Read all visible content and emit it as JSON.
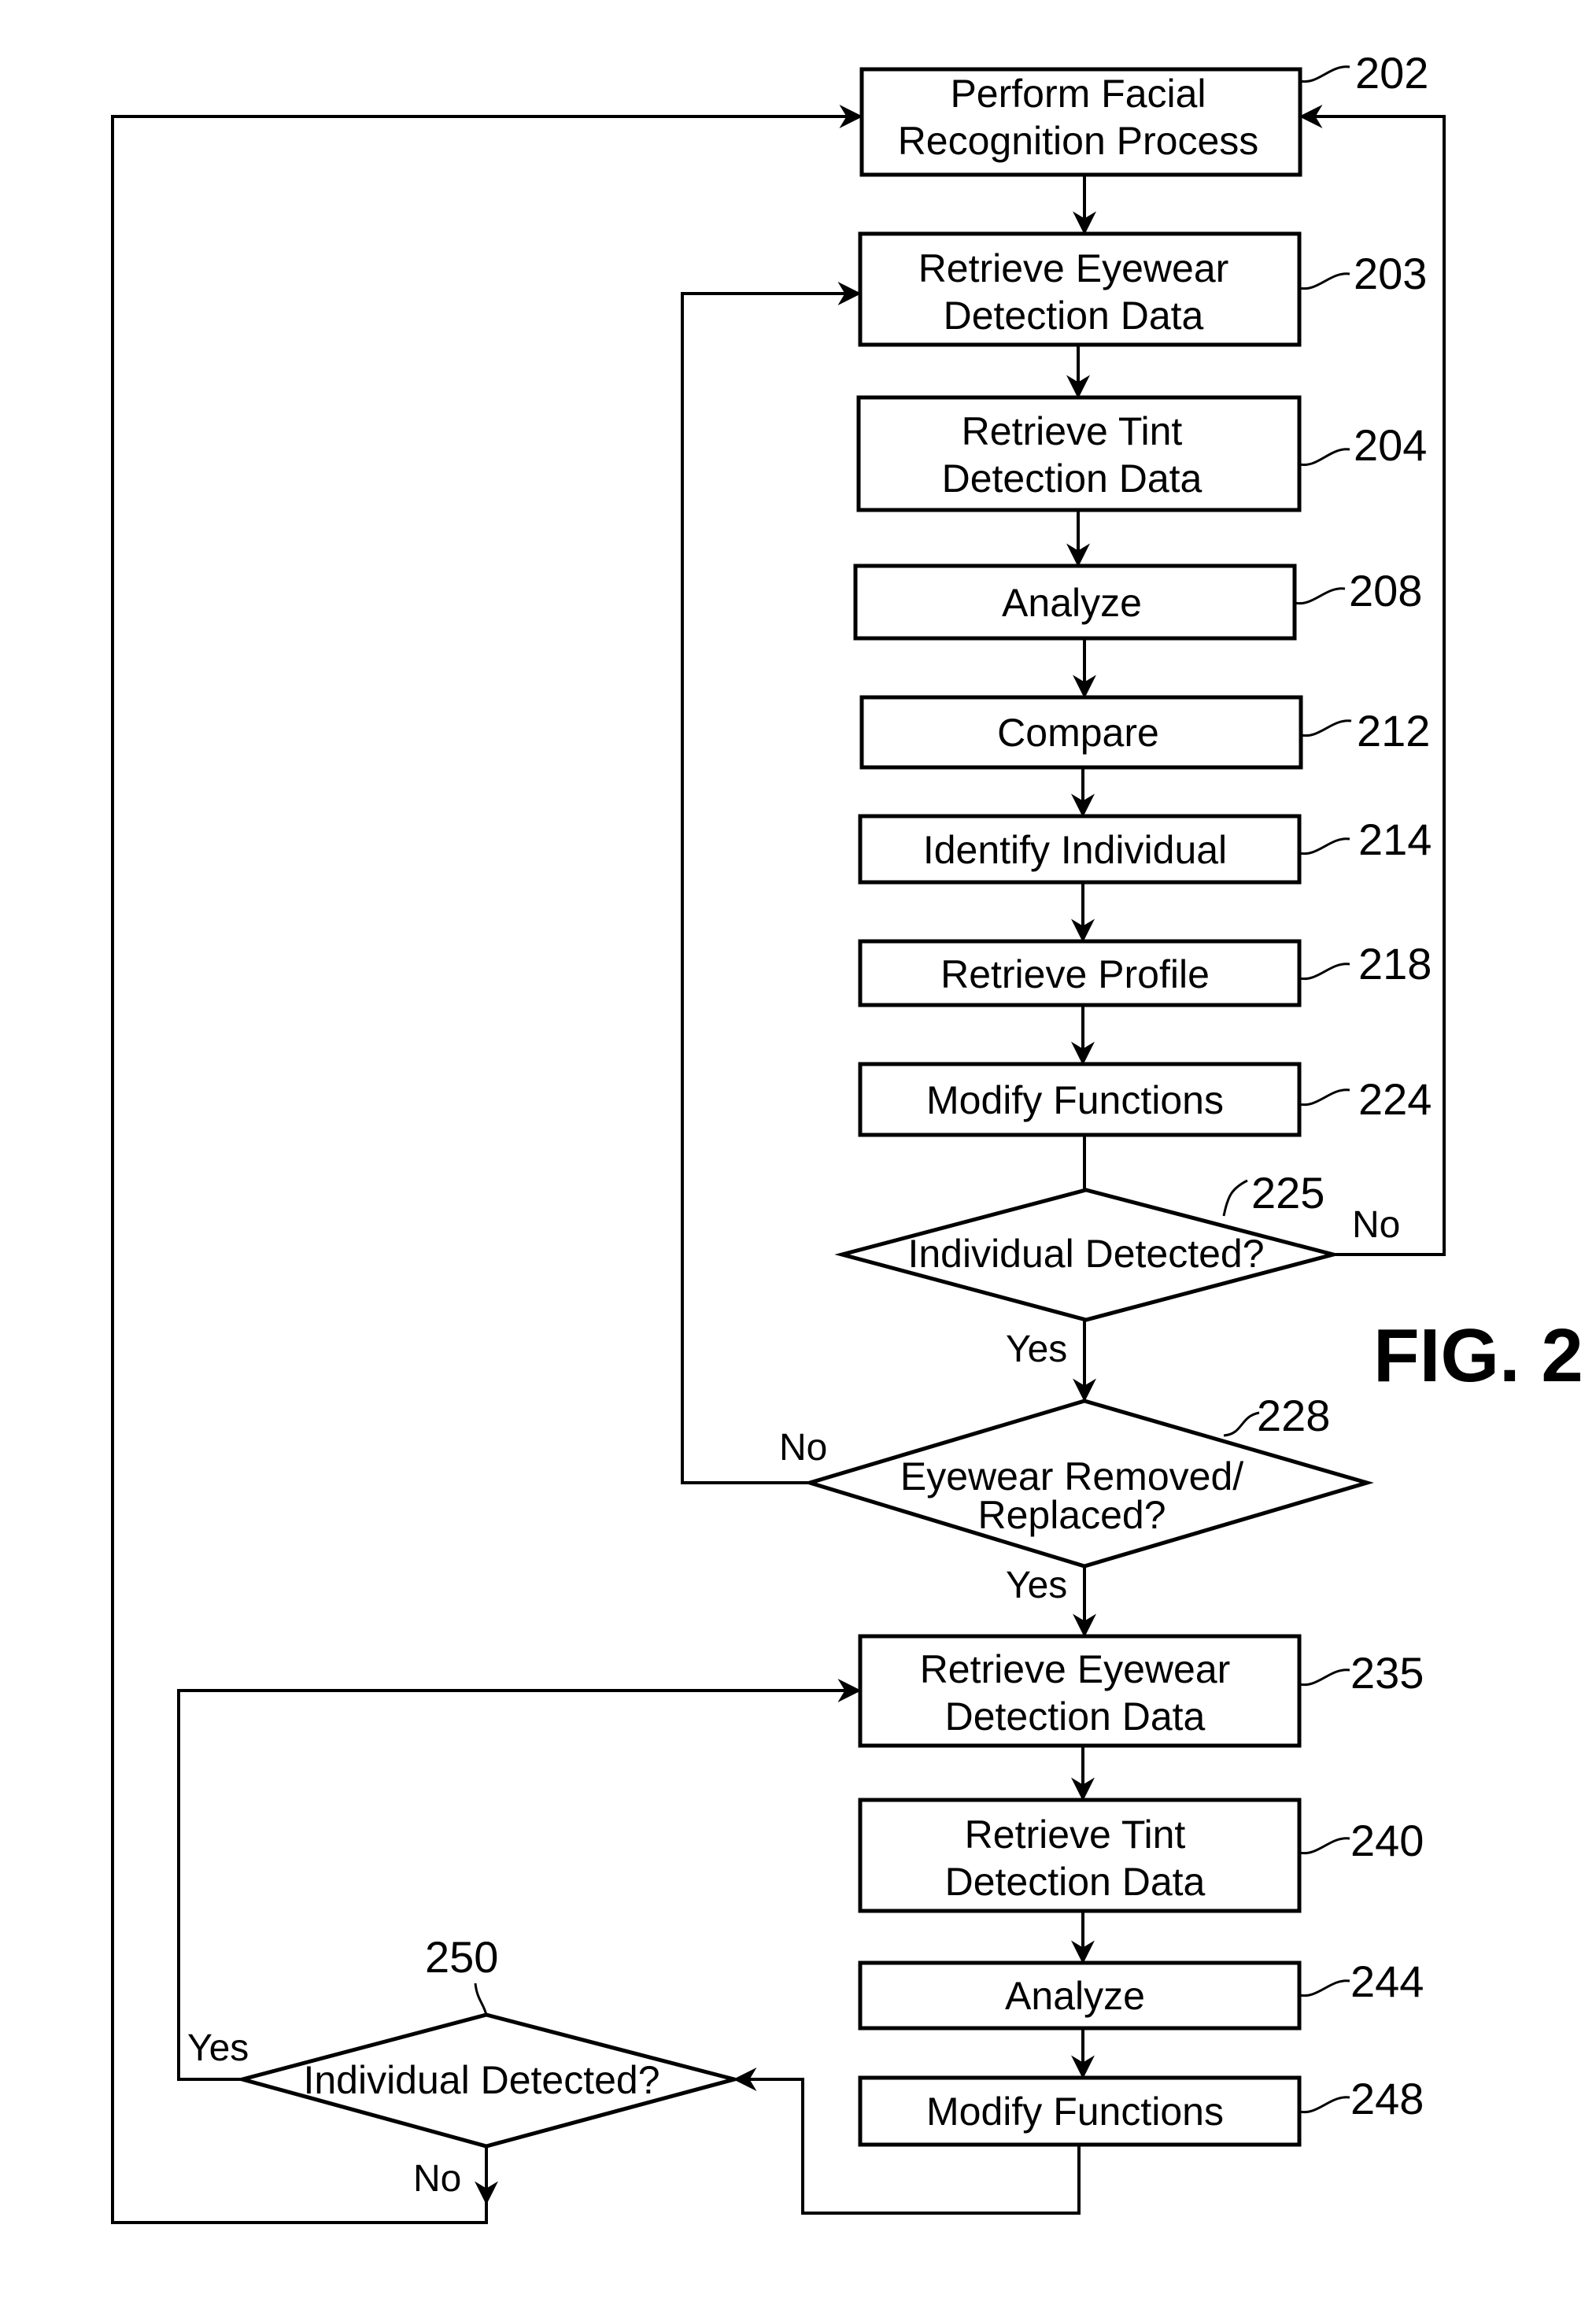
{
  "figure": {
    "title": "FIG. 2",
    "ink_color": "#000000",
    "background_color": "#ffffff"
  },
  "nodes": {
    "n202": {
      "ref": "202",
      "lines": [
        "Perform Facial",
        "Recognition Process"
      ]
    },
    "n203": {
      "ref": "203",
      "lines": [
        "Retrieve Eyewear",
        "Detection Data"
      ]
    },
    "n204": {
      "ref": "204",
      "lines": [
        "Retrieve Tint",
        "Detection Data"
      ]
    },
    "n208": {
      "ref": "208",
      "lines": [
        "Analyze"
      ]
    },
    "n212": {
      "ref": "212",
      "lines": [
        "Compare"
      ]
    },
    "n214": {
      "ref": "214",
      "lines": [
        "Identify Individual"
      ]
    },
    "n218": {
      "ref": "218",
      "lines": [
        "Retrieve Profile"
      ]
    },
    "n224": {
      "ref": "224",
      "lines": [
        "Modify Functions"
      ]
    },
    "n225": {
      "ref": "225",
      "lines": [
        "Individual Detected?"
      ]
    },
    "n228": {
      "ref": "228",
      "lines": [
        "Eyewear Removed/",
        "Replaced?"
      ]
    },
    "n235": {
      "ref": "235",
      "lines": [
        "Retrieve Eyewear",
        "Detection Data"
      ]
    },
    "n240": {
      "ref": "240",
      "lines": [
        "Retrieve Tint",
        "Detection Data"
      ]
    },
    "n244": {
      "ref": "244",
      "lines": [
        "Analyze"
      ]
    },
    "n248": {
      "ref": "248",
      "lines": [
        "Modify Functions"
      ]
    },
    "n250": {
      "ref": "250",
      "lines": [
        "Individual Detected?"
      ]
    }
  },
  "edge_labels": {
    "d225_no": "No",
    "d225_yes": "Yes",
    "d228_no": "No",
    "d228_yes": "Yes",
    "d250_yes": "Yes",
    "d250_no": "No"
  }
}
